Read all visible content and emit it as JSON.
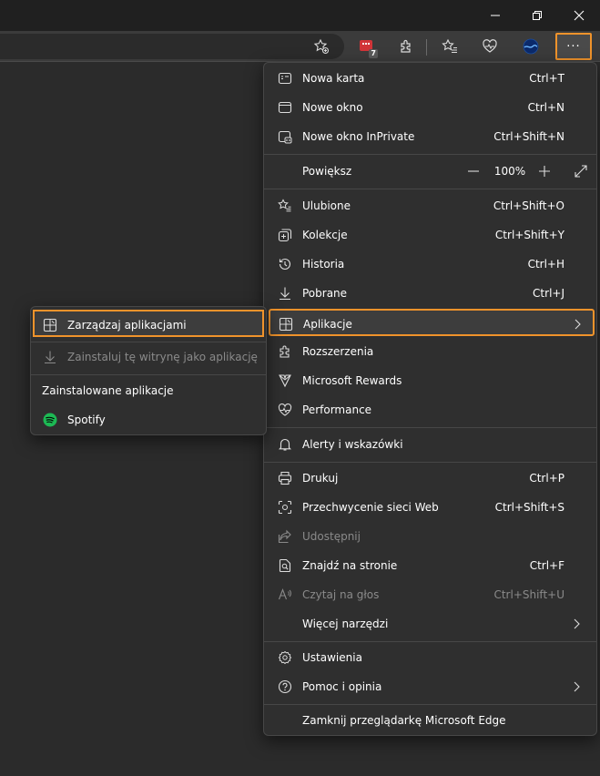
{
  "window": {
    "minimize_icon": "minimize-icon",
    "restore_icon": "restore-icon",
    "close_icon": "close-icon"
  },
  "toolbar": {
    "extension_badge": "7",
    "more_label": "···"
  },
  "menu": {
    "items": [
      {
        "label": "Nowa karta",
        "shortcut": "Ctrl+T"
      },
      {
        "label": "Nowe okno",
        "shortcut": "Ctrl+N"
      },
      {
        "label": "Nowe okno InPrivate",
        "shortcut": "Ctrl+Shift+N"
      }
    ],
    "zoom": {
      "label": "Powiększ",
      "value": "100%"
    },
    "items2": [
      {
        "label": "Ulubione",
        "shortcut": "Ctrl+Shift+O"
      },
      {
        "label": "Kolekcje",
        "shortcut": "Ctrl+Shift+Y"
      },
      {
        "label": "Historia",
        "shortcut": "Ctrl+H"
      },
      {
        "label": "Pobrane",
        "shortcut": "Ctrl+J"
      },
      {
        "label": "Aplikacje",
        "shortcut": ""
      },
      {
        "label": "Rozszerzenia",
        "shortcut": ""
      },
      {
        "label": "Microsoft Rewards",
        "shortcut": ""
      },
      {
        "label": "Performance",
        "shortcut": ""
      }
    ],
    "items3": [
      {
        "label": "Alerty i wskazówki",
        "shortcut": ""
      }
    ],
    "items4": [
      {
        "label": "Drukuj",
        "shortcut": "Ctrl+P"
      },
      {
        "label": "Przechwycenie sieci Web",
        "shortcut": "Ctrl+Shift+S"
      },
      {
        "label": "Udostępnij",
        "shortcut": ""
      },
      {
        "label": "Znajdź na stronie",
        "shortcut": "Ctrl+F"
      },
      {
        "label": "Czytaj na głos",
        "shortcut": "Ctrl+Shift+U"
      },
      {
        "label": "Więcej narzędzi",
        "shortcut": ""
      }
    ],
    "items5": [
      {
        "label": "Ustawienia",
        "shortcut": ""
      },
      {
        "label": "Pomoc i opinia",
        "shortcut": ""
      }
    ],
    "close_label": "Zamknij przeglądarkę Microsoft Edge"
  },
  "submenu": {
    "manage": "Zarządzaj aplikacjami",
    "install": "Zainstaluj tę witrynę jako aplikację",
    "installed_heading": "Zainstalowane aplikacje",
    "apps": [
      {
        "label": "Spotify"
      }
    ]
  },
  "colors": {
    "accent": "#f0932b",
    "menu_bg": "#2f2f2f",
    "spotify": "#1db954"
  }
}
